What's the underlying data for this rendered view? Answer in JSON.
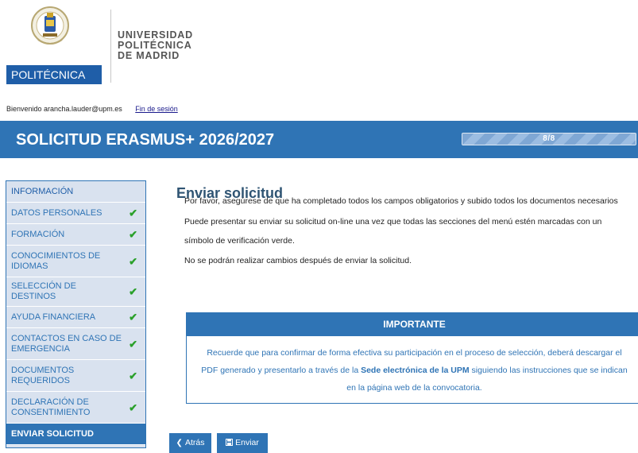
{
  "logo": {
    "badge_text": "POLITÉCNICA",
    "lines": [
      "UNIVERSIDAD",
      "POLITÉCNICA",
      "DE MADRID"
    ]
  },
  "welcome": {
    "text": "Bienvenido arancha.lauder@upm.es",
    "logout_label": "Fin de sesión"
  },
  "banner": {
    "title": "SOLICITUD ERASMUS+ 2026/2027",
    "progress_label": "8/8",
    "progress_fraction": 1.0
  },
  "sidebar": {
    "items": [
      {
        "label": "INFORMACIÓN",
        "checked": false
      },
      {
        "label": "DATOS PERSONALES",
        "checked": true
      },
      {
        "label": "FORMACIÓN",
        "checked": true
      },
      {
        "label": "CONOCIMIENTOS DE IDIOMAS",
        "checked": true
      },
      {
        "label": "SELECCIÓN DE DESTINOS",
        "checked": true
      },
      {
        "label": "AYUDA FINANCIERA",
        "checked": true
      },
      {
        "label": "CONTACTOS EN CASO DE EMERGENCIA",
        "checked": true
      },
      {
        "label": "DOCUMENTOS REQUERIDOS",
        "checked": true
      },
      {
        "label": "DECLARACIÓN DE CONSENTIMIENTO",
        "checked": true
      },
      {
        "label": "ENVIAR SOLICITUD",
        "checked": false
      }
    ],
    "check_glyph": "✔"
  },
  "main": {
    "title": "Enviar solicitud",
    "paragraphs": [
      "Por favor, asegúrese de que ha completado todos los campos obligatorios y subido todos los documentos necesarios",
      "Puede presentar su enviar su solicitud on-line una vez que todas las secciones del menú estén marcadas con un",
      "símbolo de verificación verde.",
      "No se podrán realizar cambios después de enviar la solicitud."
    ],
    "important": {
      "heading": "IMPORTANTE",
      "line1": "Recuerde que para confirmar de forma efectiva su participación en el proceso de selección, deberá descargar el",
      "line2_pre": "PDF generado y presentarlo a través de la ",
      "line2_bold": "Sede electrónica de la UPM",
      "line2_post": " siguiendo las instrucciones que se indican",
      "line3": "en la página web de la convocatoria."
    }
  },
  "buttons": {
    "back_label": "Atrás",
    "send_label": "Enviar"
  },
  "colors": {
    "primary": "#2f74b5",
    "sidebar_bg": "#d9e2ef",
    "check": "#2aa02a",
    "logo_blue": "#1f5ea8"
  },
  "icons": {
    "back": "chevron-left-icon",
    "send": "save-icon",
    "check": "checkmark-icon"
  }
}
